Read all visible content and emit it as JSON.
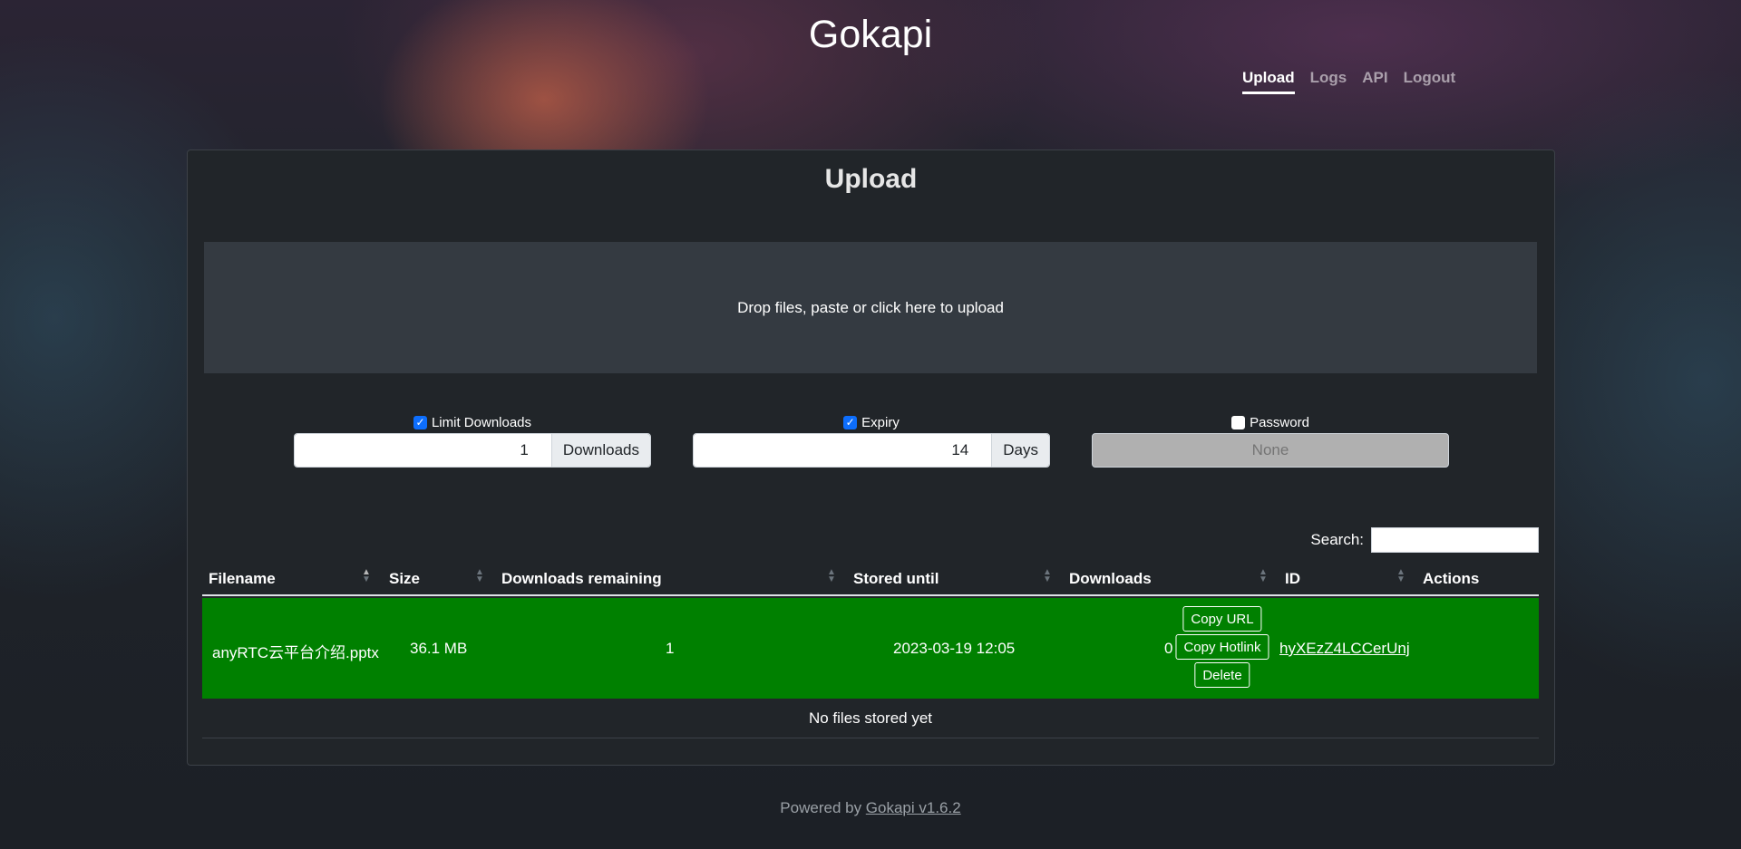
{
  "site": {
    "title": "Gokapi"
  },
  "nav": {
    "items": [
      {
        "label": "Upload"
      },
      {
        "label": "Logs"
      },
      {
        "label": "API"
      },
      {
        "label": "Logout"
      }
    ]
  },
  "upload": {
    "title": "Upload",
    "dropzone_text": "Drop files, paste or click here to upload",
    "limit_downloads": {
      "label": "Limit Downloads",
      "checked": true,
      "value": "1",
      "unit": "Downloads"
    },
    "expiry": {
      "label": "Expiry",
      "checked": true,
      "value": "14",
      "unit": "Days"
    },
    "password": {
      "label": "Password",
      "checked": false,
      "placeholder": "None"
    }
  },
  "search": {
    "label": "Search:",
    "value": ""
  },
  "table": {
    "columns": [
      "Filename",
      "Size",
      "Downloads remaining",
      "Stored until",
      "Downloads",
      "ID",
      "Actions"
    ],
    "rows": [
      {
        "filename": "anyRTC云平台介绍.pptx",
        "size": "36.1 MB",
        "downloads_remaining": "1",
        "stored_until": "2023-03-19 12:05",
        "downloads": "0",
        "id": "hyXEzZ4LCCerUnj",
        "actions": [
          "Copy URL",
          "Copy Hotlink",
          "Delete"
        ],
        "highlight_color": "#008000"
      }
    ],
    "empty_text": "No files stored yet"
  },
  "footer": {
    "prefix": "Powered by ",
    "link": "Gokapi v1.6.2"
  },
  "colors": {
    "accent": "#0d6efd",
    "row_highlight": "#008000",
    "card_bg": "#212529"
  }
}
